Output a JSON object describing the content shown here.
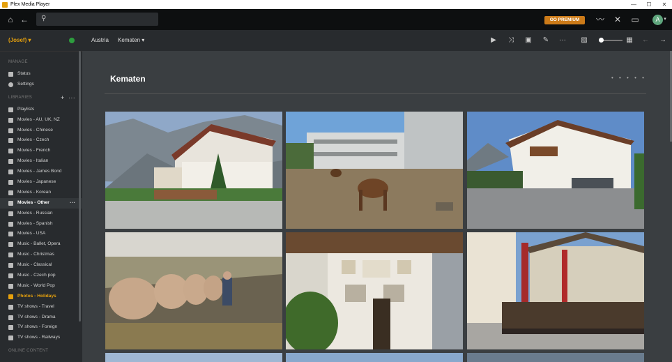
{
  "window": {
    "title": "Plex Media Player"
  },
  "topbar": {
    "search_placeholder": "",
    "premium_label": "GO PREMIUM",
    "avatar_initial": "A"
  },
  "sidebar": {
    "user": "(Josef) ▾",
    "manage_title": "MANAGE",
    "manage_items": [
      "Status",
      "Settings"
    ],
    "libraries_title": "LIBRARIES",
    "libraries": [
      "Playlists",
      "Movies - AU, UK, NZ",
      "Movies - Chinese",
      "Movies - Czech",
      "Movies - French",
      "Movies - Italian",
      "Movies - James Bond",
      "Movies - Japanese",
      "Movies - Korean",
      "Movies - Other",
      "Movies - Russian",
      "Movies - Spanish",
      "Movies - USA",
      "Music - Ballet, Opera",
      "Music - Christmas",
      "Music - Classical",
      "Music - Czech pop",
      "Music - World Pop",
      "Photos - Holidays",
      "TV shows - Travel",
      "TV shows - Drama",
      "TV shows - Foreign",
      "TV shows - Railways"
    ],
    "online_title": "ONLINE CONTENT"
  },
  "breadcrumb": {
    "parent": "Austria",
    "current": "Kematen ▾"
  },
  "main": {
    "title": "Kematen",
    "dots": "• • • • •"
  },
  "colors": {
    "accent": "#e5a00d",
    "premium": "#cc7b19"
  }
}
